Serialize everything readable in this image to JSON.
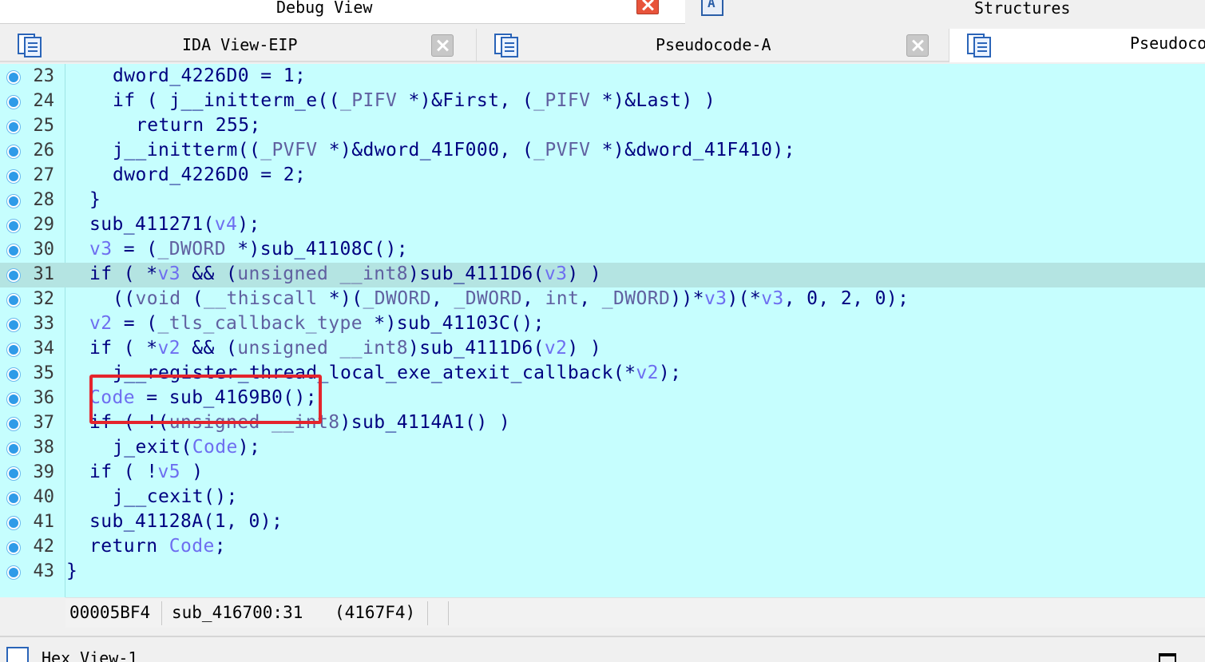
{
  "top_tabs": {
    "debug_view": "Debug View",
    "structures": "Structures"
  },
  "tabs": {
    "ida_view": "IDA View-EIP",
    "pseudocode_a": "Pseudocode-A",
    "pseudocode_b": "Pseudocode-B"
  },
  "code_lines": [
    {
      "n": "23",
      "text": "dword_4226D0 = 1;"
    },
    {
      "n": "24",
      "text": "if ( j__initterm_e((_PIFV *)&First, (_PIFV *)&Last) )"
    },
    {
      "n": "25",
      "text": "return 255;"
    },
    {
      "n": "26",
      "text": "j__initterm((_PVFV *)&dword_41F000, (_PVFV *)&dword_41F410);"
    },
    {
      "n": "27",
      "text": "dword_4226D0 = 2;"
    },
    {
      "n": "28",
      "text": "}"
    },
    {
      "n": "29",
      "text": "sub_411271(v4);"
    },
    {
      "n": "30",
      "text": "v3 = (_DWORD *)sub_41108C();"
    },
    {
      "n": "31",
      "text": "if ( *v3 && (unsigned __int8)sub_4111D6(v3) )"
    },
    {
      "n": "32",
      "text": "((void (__thiscall *)(_DWORD, _DWORD, int, _DWORD))*v3)(*v3, 0, 2, 0);"
    },
    {
      "n": "33",
      "text": "v2 = (_tls_callback_type *)sub_41103C();"
    },
    {
      "n": "34",
      "text": "if ( *v2 && (unsigned __int8)sub_4111D6(v2) )"
    },
    {
      "n": "35",
      "text": "j__register_thread_local_exe_atexit_callback(*v2);"
    },
    {
      "n": "36",
      "text": "Code = sub_4169B0();"
    },
    {
      "n": "37",
      "text": "if ( !(unsigned __int8)sub_4114A1() )"
    },
    {
      "n": "38",
      "text": "j_exit(Code);"
    },
    {
      "n": "39",
      "text": "if ( !v5 )"
    },
    {
      "n": "40",
      "text": "j__cexit();"
    },
    {
      "n": "41",
      "text": "sub_41128A(1, 0);"
    },
    {
      "n": "42",
      "text": "return Code;"
    },
    {
      "n": "43",
      "text": "}"
    }
  ],
  "status_bar": {
    "offset": "00005BF4",
    "location": "sub_416700:31",
    "address": "(4167F4)"
  },
  "bottom_panel": {
    "title": "Hex View-1"
  },
  "colors": {
    "code_background": "#c6fefe",
    "highlight_line": "#b4e4e2",
    "annotation_box": "#e4242c",
    "breakpoint_dot": "#2e9be8"
  },
  "icons": [
    "close-icon",
    "structures-icon",
    "disassembly-icon",
    "pseudocode-icon",
    "hex-view-icon",
    "maximize-icon",
    "breakpoint-dot-icon"
  ]
}
